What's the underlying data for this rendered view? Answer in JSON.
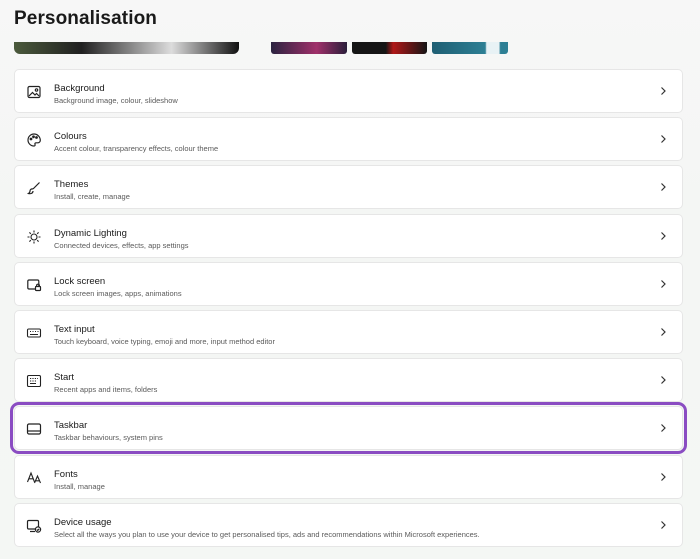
{
  "page": {
    "title": "Personalisation"
  },
  "items": [
    {
      "label": "Background",
      "description": "Background image, colour, slideshow",
      "icon": "image-icon"
    },
    {
      "label": "Colours",
      "description": "Accent colour, transparency effects, colour theme",
      "icon": "palette-icon"
    },
    {
      "label": "Themes",
      "description": "Install, create, manage",
      "icon": "brush-icon"
    },
    {
      "label": "Dynamic Lighting",
      "description": "Connected devices, effects, app settings",
      "icon": "sun-icon"
    },
    {
      "label": "Lock screen",
      "description": "Lock screen images, apps, animations",
      "icon": "lock-screen-icon"
    },
    {
      "label": "Text input",
      "description": "Touch keyboard, voice typing, emoji and more, input method editor",
      "icon": "keyboard-icon"
    },
    {
      "label": "Start",
      "description": "Recent apps and items, folders",
      "icon": "start-icon"
    },
    {
      "label": "Taskbar",
      "description": "Taskbar behaviours, system pins",
      "icon": "taskbar-icon",
      "highlighted": true
    },
    {
      "label": "Fonts",
      "description": "Install, manage",
      "icon": "fonts-icon"
    },
    {
      "label": "Device usage",
      "description": "Select all the ways you plan to use your device to get personalised tips, ads and recommendations within Microsoft experiences.",
      "icon": "device-usage-icon"
    }
  ],
  "colors": {
    "highlight": "#8a4cc2"
  }
}
